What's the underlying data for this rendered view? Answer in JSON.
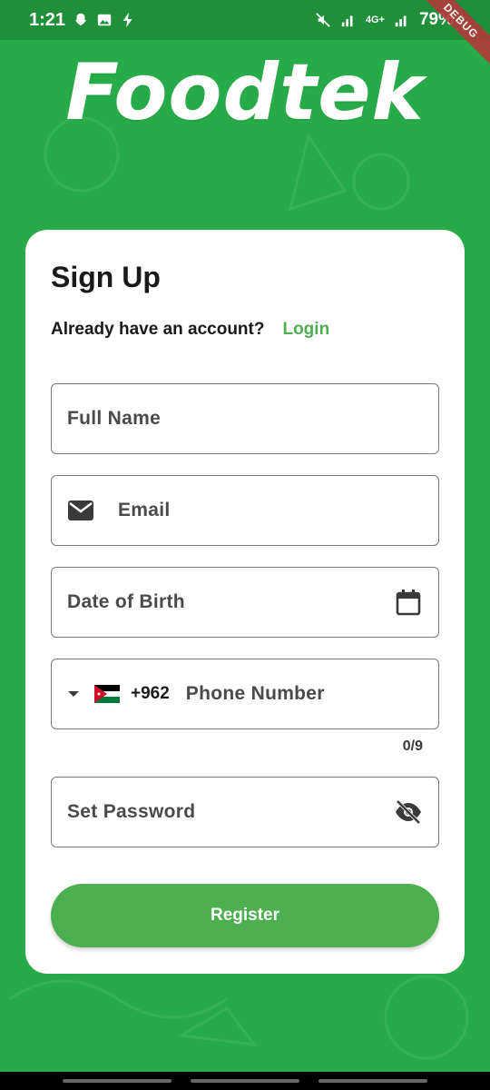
{
  "status_bar": {
    "time": "1:21",
    "network": "4G+",
    "battery": "79%",
    "debug_label": "DEBUG"
  },
  "logo": {
    "text": "Foodtek"
  },
  "form": {
    "title": "Sign Up",
    "account_prompt": "Already have an account?",
    "login_link": "Login",
    "full_name_placeholder": "Full Name",
    "email_placeholder": "Email",
    "dob_placeholder": "Date of Birth",
    "phone": {
      "dial_code": "+962",
      "placeholder": "Phone Number",
      "counter": "0/9",
      "flag": "jordan-flag"
    },
    "password_placeholder": "Set Password",
    "register_label": "Register"
  },
  "colors": {
    "background": "#27ab48",
    "accent": "#4caf50",
    "card": "#ffffff"
  }
}
